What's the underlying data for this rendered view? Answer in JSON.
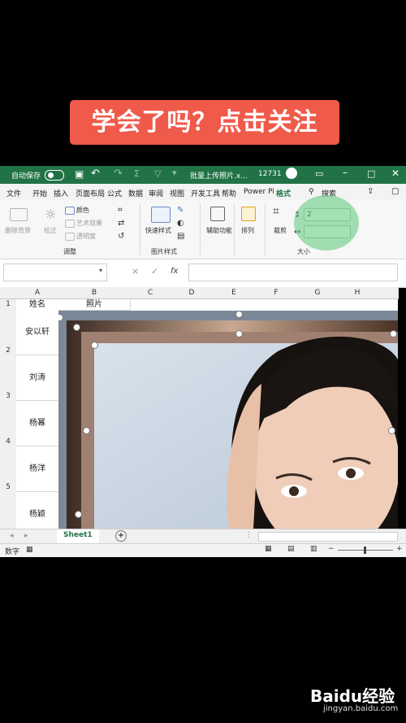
{
  "banner": {
    "text": "学会了吗？点击关注"
  },
  "titlebar": {
    "autosave_label": "自动保存",
    "toggle_state": "关",
    "file_name": "批量上传照片.x...",
    "counter": "12731"
  },
  "tabs": [
    "文件",
    "开始",
    "插入",
    "页面布局",
    "公式",
    "数据",
    "审阅",
    "视图",
    "开发工具",
    "帮助",
    "Power Pi",
    "格式",
    "搜索"
  ],
  "ribbon": {
    "remove_bg": "删除背景",
    "correct": "校正",
    "color": "颜色",
    "art_effects": "艺术效果",
    "transparency": "透明度",
    "group_adjust": "调整",
    "quick_styles": "快速样式",
    "group_picture_styles": "图片样式",
    "alt_text": "辅助功能",
    "arrange": "排列",
    "crop": "裁剪",
    "size_value": "2",
    "group_size": "大小"
  },
  "formula": {
    "cancel": "×",
    "confirm": "✓",
    "fx": "fx"
  },
  "columns": [
    "A",
    "B",
    "C",
    "D",
    "E",
    "F",
    "G",
    "H"
  ],
  "rows": [
    "1",
    "2",
    "3",
    "4",
    "5"
  ],
  "header_row": {
    "a": "姓名",
    "b": "照片"
  },
  "names": [
    "安以轩",
    "刘涛",
    "杨幂",
    "杨洋",
    "杨颖"
  ],
  "sheet": {
    "tab": "Sheet1",
    "add": "+"
  },
  "status": {
    "mode": "数字"
  },
  "watermark": {
    "brand": "Baidu经验",
    "url": "jingyan.baidu.com"
  }
}
